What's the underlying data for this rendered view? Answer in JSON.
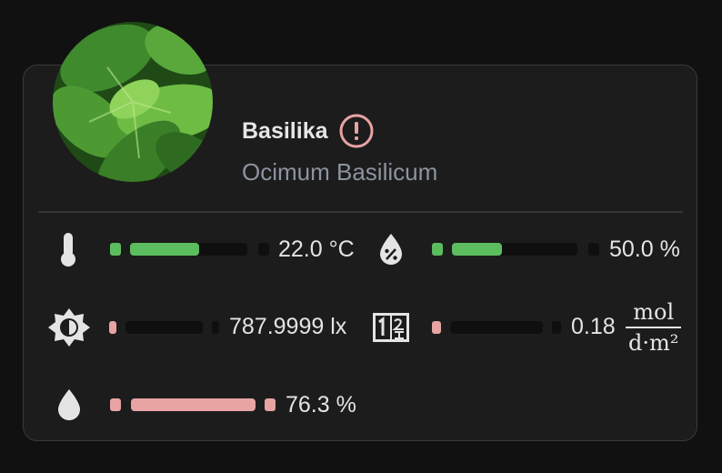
{
  "plant": {
    "name": "Basilika",
    "species": "Ocimum Basilicum"
  },
  "colors": {
    "ok": "#5cbd5f",
    "warning": "#e8a3a3",
    "card_bg": "#1c1c1c"
  },
  "sensors": {
    "temperature": {
      "icon": "thermometer-icon",
      "value": "22.0 °C",
      "level": 0.59,
      "status": "ok"
    },
    "moisture": {
      "icon": "water-percent-icon",
      "value": "50.0 %",
      "level": 0.4,
      "status": "ok"
    },
    "illuminance": {
      "icon": "brightness-icon",
      "value": "787.9999 lx",
      "level": 0.0,
      "status": "low"
    },
    "dli": {
      "icon": "counter-icon",
      "value": "0.18",
      "level": 0.0,
      "status": "low",
      "unit_num": "mol",
      "unit_den": "d·m²"
    },
    "humidity": {
      "icon": "water-icon",
      "value": "76.3 %",
      "level": 1.0,
      "status": "high"
    }
  }
}
